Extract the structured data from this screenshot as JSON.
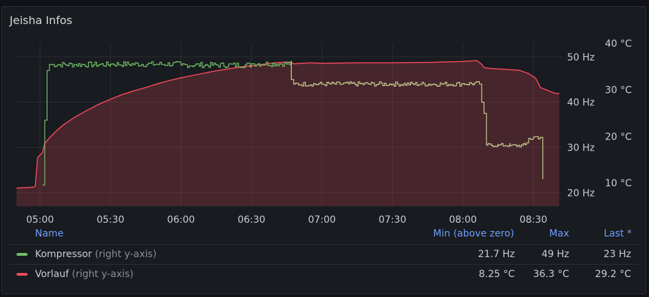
{
  "panel": {
    "title": "Jeisha Infos"
  },
  "legend": {
    "columns": {
      "name": "Name",
      "min": "Min (above zero)",
      "max": "Max",
      "last": "Last *"
    },
    "rows": [
      {
        "name": "Kompressor",
        "axis_note": "(right y-axis)",
        "color": "#73bf69",
        "min": "21.7 Hz",
        "max": "49 Hz",
        "last": "23 Hz"
      },
      {
        "name": "Vorlauf",
        "axis_note": "(right y-axis)",
        "color": "#f2495c",
        "min": "8.25 °C",
        "max": "36.3 °C",
        "last": "29.2 °C"
      }
    ]
  },
  "chart_data": {
    "type": "line",
    "x_axis": {
      "unit": "time",
      "range": [
        "04:50",
        "08:42"
      ],
      "ticks": [
        "05:00",
        "05:30",
        "06:00",
        "06:30",
        "07:00",
        "07:30",
        "08:00",
        "08:30"
      ]
    },
    "y_axes": [
      {
        "id": "hz",
        "unit": "Hz",
        "range": [
          17,
          53
        ],
        "ticks": [
          "20 Hz",
          "30 Hz",
          "40 Hz",
          "50 Hz"
        ],
        "tick_values": [
          20,
          30,
          40,
          50
        ]
      },
      {
        "id": "temp",
        "unit": "°C",
        "range": [
          5,
          40
        ],
        "ticks": [
          "10 °C",
          "20 °C",
          "30 °C",
          "40 °C"
        ],
        "tick_values": [
          10,
          20,
          30,
          40
        ]
      }
    ],
    "grid": true,
    "series": [
      {
        "name": "Vorlauf",
        "axis": "temp",
        "color": "#f2495c",
        "fill": true,
        "points": [
          [
            "04:50",
            8.9
          ],
          [
            "04:57",
            9.1
          ],
          [
            "04:58",
            9.3
          ],
          [
            "04:59",
            15.5
          ],
          [
            "05:01",
            16.5
          ],
          [
            "05:02",
            18.5
          ],
          [
            "05:04",
            19.7
          ],
          [
            "05:07",
            21.2
          ],
          [
            "05:10",
            22.5
          ],
          [
            "05:15",
            24.2
          ],
          [
            "05:20",
            25.6
          ],
          [
            "05:25",
            26.9
          ],
          [
            "05:30",
            28.0
          ],
          [
            "05:35",
            29.0
          ],
          [
            "05:40",
            29.8
          ],
          [
            "05:45",
            30.5
          ],
          [
            "05:50",
            31.3
          ],
          [
            "05:55",
            32.0
          ],
          [
            "06:00",
            32.6
          ],
          [
            "06:05",
            33.1
          ],
          [
            "06:10",
            33.6
          ],
          [
            "06:15",
            34.1
          ],
          [
            "06:20",
            34.5
          ],
          [
            "06:25",
            34.9
          ],
          [
            "06:30",
            35.2
          ],
          [
            "06:35",
            35.5
          ],
          [
            "06:40",
            35.8
          ],
          [
            "06:45",
            36.0
          ],
          [
            "06:47",
            35.9
          ],
          [
            "06:48",
            35.6
          ],
          [
            "06:55",
            35.8
          ],
          [
            "07:00",
            35.7
          ],
          [
            "07:15",
            35.8
          ],
          [
            "07:30",
            35.8
          ],
          [
            "07:45",
            35.9
          ],
          [
            "08:00",
            36.1
          ],
          [
            "08:06",
            36.3
          ],
          [
            "08:08",
            35.5
          ],
          [
            "08:09",
            34.8
          ],
          [
            "08:12",
            34.6
          ],
          [
            "08:18",
            34.4
          ],
          [
            "08:24",
            34.2
          ],
          [
            "08:28",
            33.5
          ],
          [
            "08:31",
            32.5
          ],
          [
            "08:33",
            30.5
          ],
          [
            "08:36",
            29.9
          ],
          [
            "08:39",
            29.3
          ],
          [
            "08:41",
            29.2
          ]
        ]
      },
      {
        "name": "Kompressor",
        "axis": "hz",
        "color": "#73bf69",
        "color_late": "#c8cf8f",
        "fill": false,
        "points": [
          [
            "05:01",
            21.7
          ],
          [
            "05:02",
            36.0
          ],
          [
            "05:03",
            47.0
          ],
          [
            "05:04",
            48.3
          ],
          [
            "05:15",
            48.3
          ],
          [
            "05:30",
            48.4
          ],
          [
            "06:00",
            48.2
          ],
          [
            "06:30",
            48.5
          ],
          [
            "06:47",
            48.5
          ],
          [
            "06:47",
            45.0
          ],
          [
            "06:48",
            44.0
          ],
          [
            "07:00",
            44.0
          ],
          [
            "07:30",
            44.0
          ],
          [
            "08:00",
            44.1
          ],
          [
            "08:07",
            44.0
          ],
          [
            "08:08",
            40.0
          ],
          [
            "08:09",
            37.5
          ],
          [
            "08:10",
            30.5
          ],
          [
            "08:15",
            30.5
          ],
          [
            "08:20",
            30.4
          ],
          [
            "08:25",
            30.5
          ],
          [
            "08:27",
            31.0
          ],
          [
            "08:28",
            32.0
          ],
          [
            "08:30",
            32.3
          ],
          [
            "08:33",
            32.2
          ],
          [
            "08:34",
            23.0
          ]
        ],
        "jitter": [
          [
            "05:04",
            "06:47",
            0.6
          ],
          [
            "06:48",
            "08:07",
            0.5
          ],
          [
            "08:10",
            "08:27",
            0.4
          ],
          [
            "08:28",
            "08:33",
            0.6
          ]
        ]
      }
    ]
  }
}
